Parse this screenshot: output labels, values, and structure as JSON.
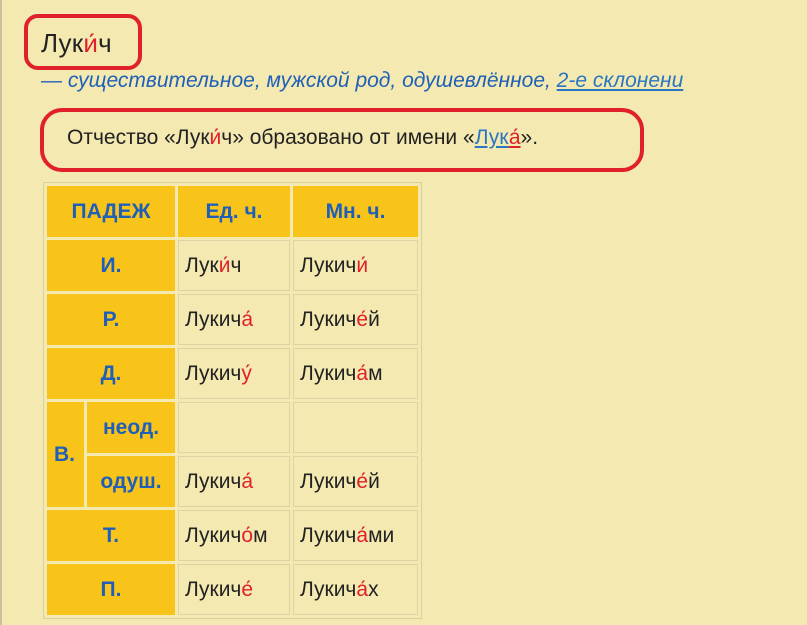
{
  "title": {
    "word": "Луки́ч",
    "before": "Лук",
    "stressed": "и́",
    "after": "ч"
  },
  "subtitle": {
    "text": "— существительное, мужской род, одушевлённое, ",
    "link": "2-е склонени"
  },
  "origin": {
    "prefix": "Отчество «Лук",
    "stressed": "и́",
    "middle": "ч» образовано от имени «",
    "link_before": "Лук",
    "link_stressed": "а́",
    "suffix": "»."
  },
  "table": {
    "headers": [
      "ПАДЕЖ",
      "Ед. ч.",
      "Мн. ч."
    ],
    "rows": [
      {
        "case": "И.",
        "sg": [
          "Лук",
          "и́",
          "ч"
        ],
        "pl": [
          "Лукич",
          "и́",
          ""
        ]
      },
      {
        "case": "Р.",
        "sg": [
          "Лукич",
          "а́",
          ""
        ],
        "pl": [
          "Лукич",
          "е́",
          "й"
        ]
      },
      {
        "case": "Д.",
        "sg": [
          "Лукич",
          "у́",
          ""
        ],
        "pl": [
          "Лукич",
          "а́",
          "м"
        ]
      },
      {
        "case": "В.",
        "sub": "неод.",
        "sg": [
          "",
          "",
          ""
        ],
        "pl": [
          "",
          "",
          ""
        ]
      },
      {
        "case": "В.",
        "sub": "одуш.",
        "sg": [
          "Лукич",
          "а́",
          ""
        ],
        "pl": [
          "Лукич",
          "е́",
          "й"
        ]
      },
      {
        "case": "Т.",
        "sg": [
          "Лукич",
          "о́",
          "м"
        ],
        "pl": [
          "Лукич",
          "а́",
          "ми"
        ]
      },
      {
        "case": "П.",
        "sg": [
          "Лукич",
          "е́",
          ""
        ],
        "pl": [
          "Лукич",
          "а́",
          "х"
        ]
      }
    ]
  },
  "colors": {
    "background": "#f3e9b1",
    "header": "#f9c41a",
    "link": "#1f5fb8",
    "stress": "#e0202a",
    "highlight": "#e0202a"
  }
}
